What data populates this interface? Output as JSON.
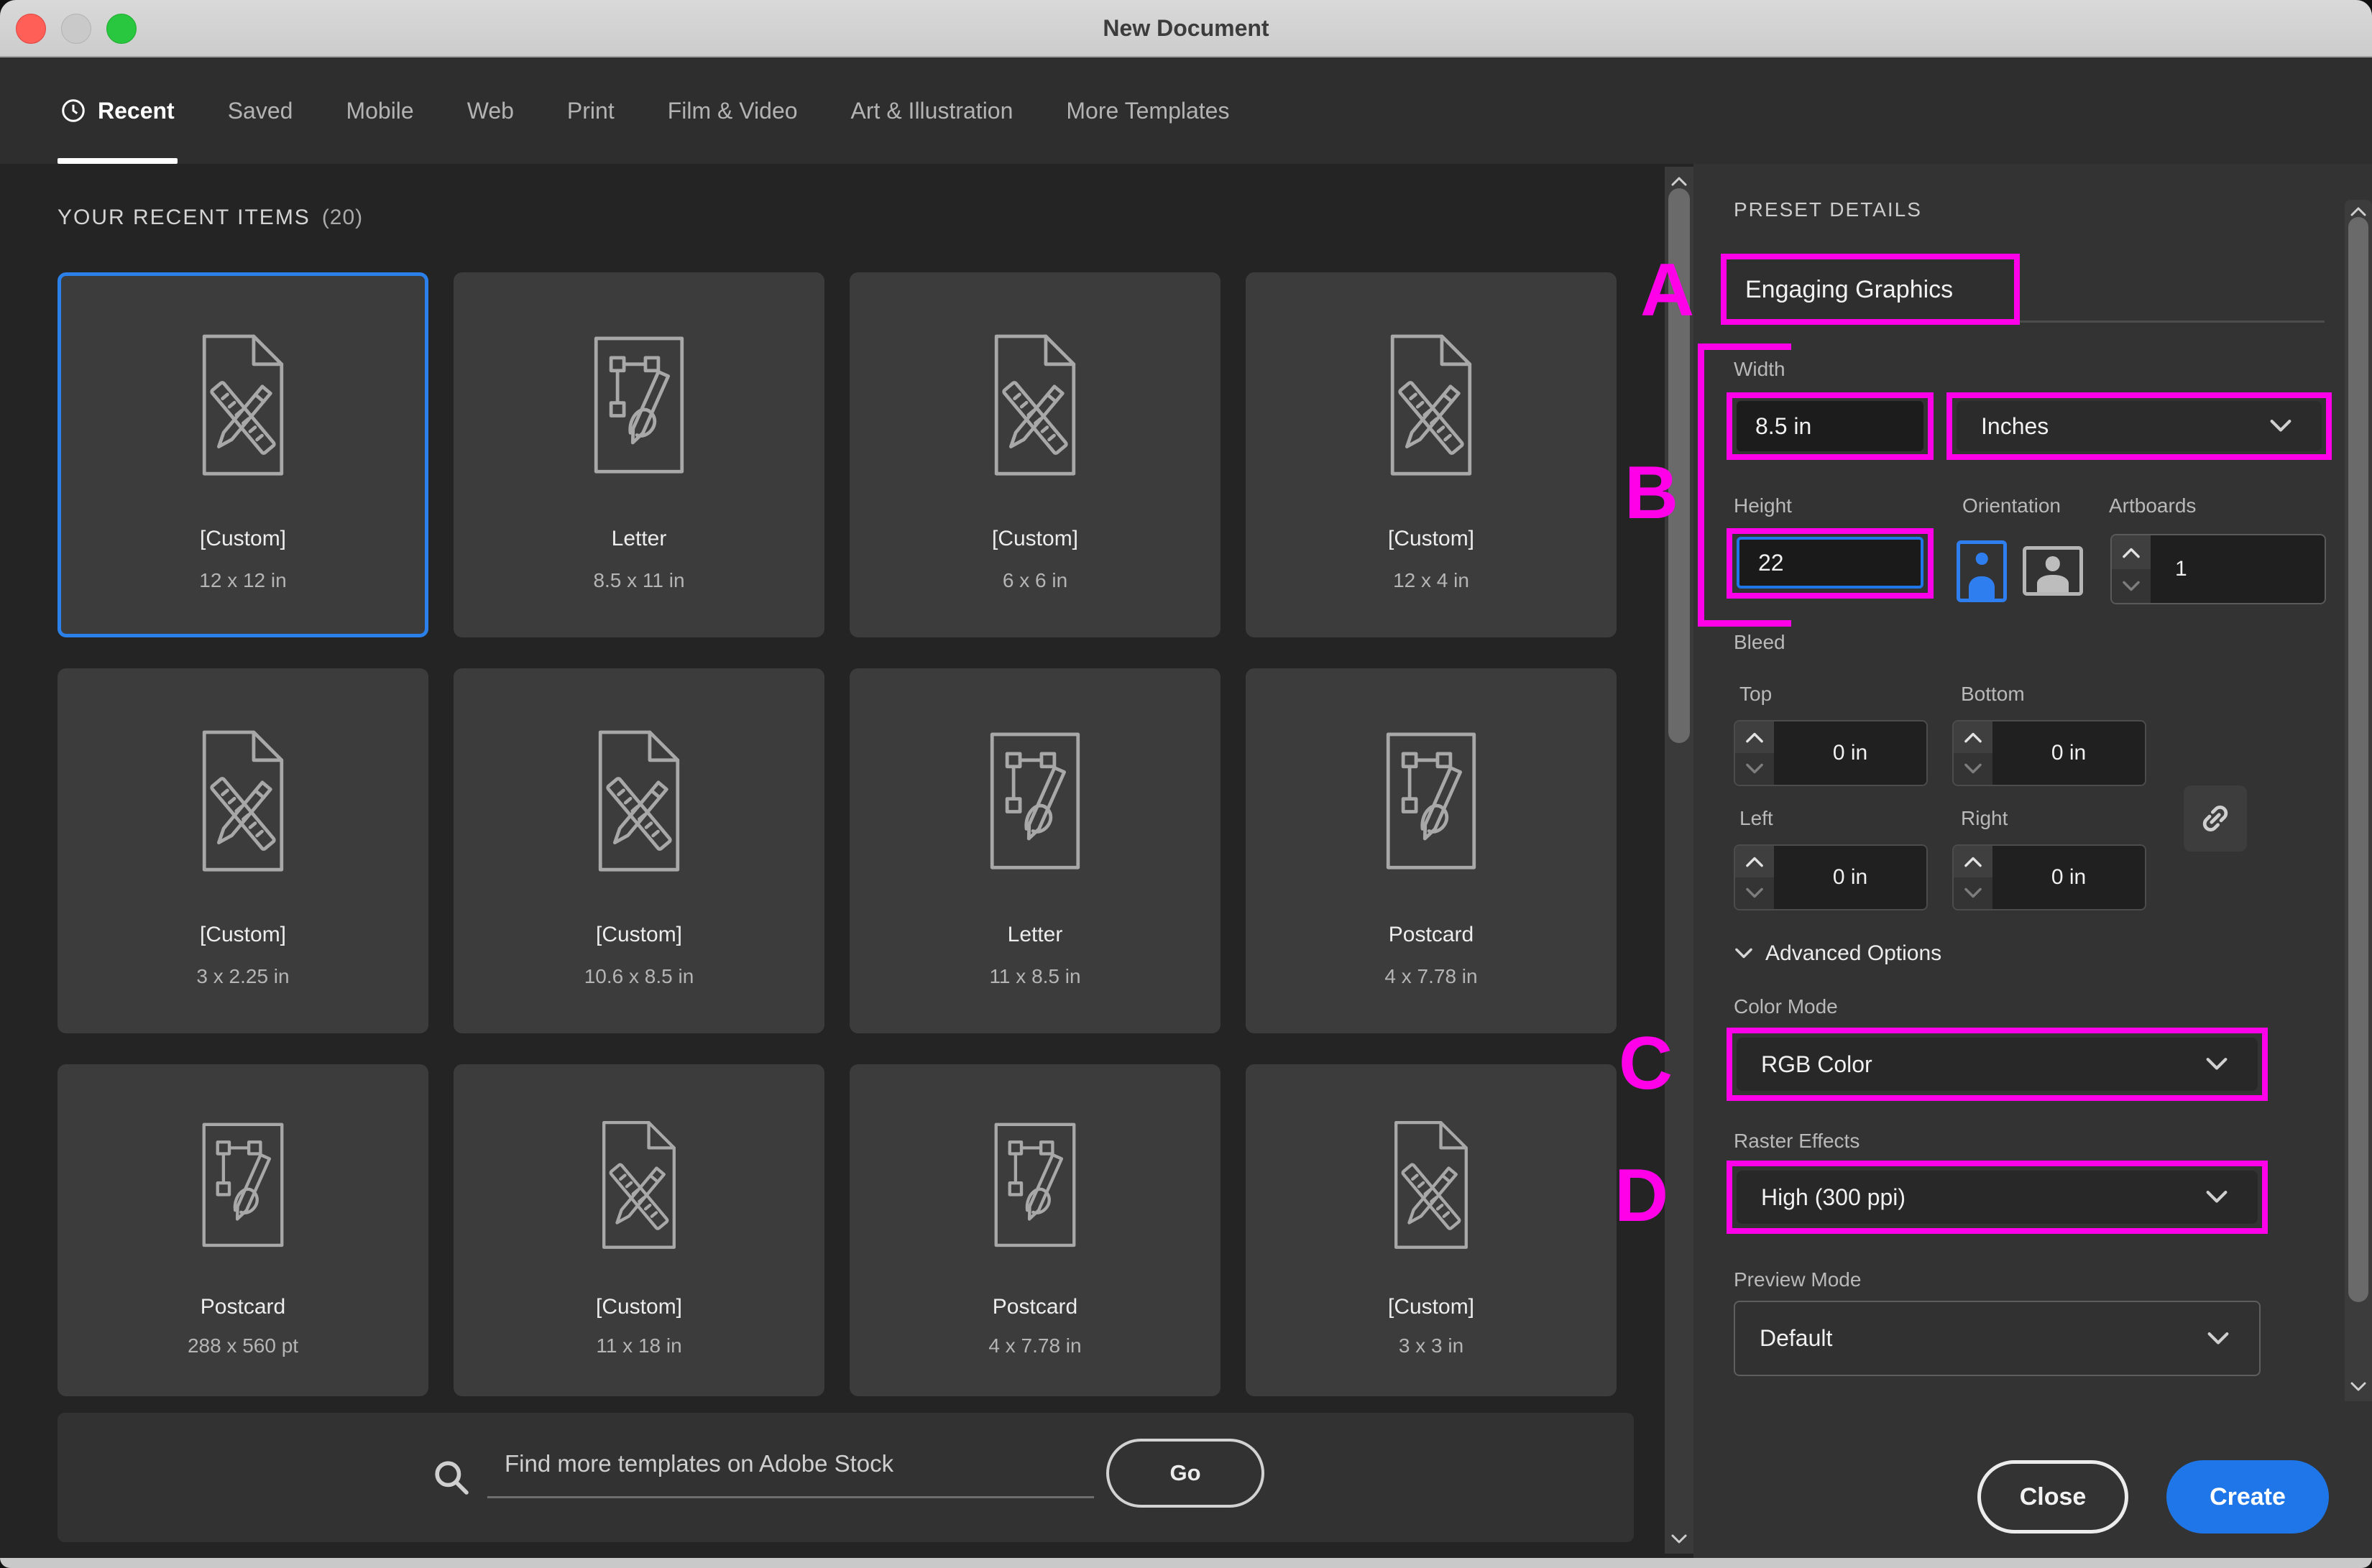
{
  "window": {
    "title": "New Document"
  },
  "tabs": [
    {
      "label": "Recent",
      "active": true,
      "icon": "clock-icon"
    },
    {
      "label": "Saved"
    },
    {
      "label": "Mobile"
    },
    {
      "label": "Web"
    },
    {
      "label": "Print"
    },
    {
      "label": "Film & Video"
    },
    {
      "label": "Art & Illustration"
    },
    {
      "label": "More Templates"
    }
  ],
  "recent": {
    "heading": "YOUR RECENT ITEMS",
    "count": "(20)",
    "cards": [
      {
        "name": "[Custom]",
        "dims": "12 x 12 in",
        "icon": "doc-icon",
        "selected": true
      },
      {
        "name": "Letter",
        "dims": "8.5 x 11 in",
        "icon": "vector-icon"
      },
      {
        "name": "[Custom]",
        "dims": "6 x 6 in",
        "icon": "doc-icon"
      },
      {
        "name": "[Custom]",
        "dims": "12 x 4 in",
        "icon": "doc-icon"
      },
      {
        "name": "[Custom]",
        "dims": "3 x 2.25 in",
        "icon": "doc-icon"
      },
      {
        "name": "[Custom]",
        "dims": "10.6 x 8.5 in",
        "icon": "doc-icon"
      },
      {
        "name": "Letter",
        "dims": "11 x 8.5 in",
        "icon": "vector-icon"
      },
      {
        "name": "Postcard",
        "dims": "4 x 7.78 in",
        "icon": "vector-icon"
      },
      {
        "name": "Postcard",
        "dims": "288 x 560 pt",
        "icon": "vector-icon"
      },
      {
        "name": "[Custom]",
        "dims": "11 x 18 in",
        "icon": "doc-icon"
      },
      {
        "name": "Postcard",
        "dims": "4 x 7.78 in",
        "icon": "vector-icon"
      },
      {
        "name": "[Custom]",
        "dims": "3 x 3 in",
        "icon": "doc-icon"
      }
    ]
  },
  "search": {
    "placeholder": "Find more templates on Adobe Stock",
    "go_label": "Go"
  },
  "preset": {
    "heading": "PRESET DETAILS",
    "name_value": "Engaging Graphics",
    "width": {
      "label": "Width",
      "value": "8.5 in"
    },
    "units": {
      "value": "Inches"
    },
    "height": {
      "label": "Height",
      "value": "22"
    },
    "orientation": {
      "label": "Orientation"
    },
    "artboards": {
      "label": "Artboards",
      "value": "1"
    },
    "bleed": {
      "label": "Bleed",
      "top": {
        "label": "Top",
        "value": "0 in"
      },
      "bottom": {
        "label": "Bottom",
        "value": "0 in"
      },
      "left": {
        "label": "Left",
        "value": "0 in"
      },
      "right": {
        "label": "Right",
        "value": "0 in"
      }
    },
    "advanced": {
      "label": "Advanced Options"
    },
    "color_mode": {
      "label": "Color Mode",
      "value": "RGB Color"
    },
    "raster": {
      "label": "Raster Effects",
      "value": "High (300 ppi)"
    },
    "preview": {
      "label": "Preview Mode",
      "value": "Default"
    },
    "close_label": "Close",
    "create_label": "Create"
  },
  "annotations": {
    "a": "A",
    "b": "B",
    "c": "C",
    "d": "D",
    "color": "#ff00e8"
  },
  "colors": {
    "accent_blue": "#1e76e8",
    "selection_border": "#2b80ea",
    "magenta": "#ff00e8"
  }
}
